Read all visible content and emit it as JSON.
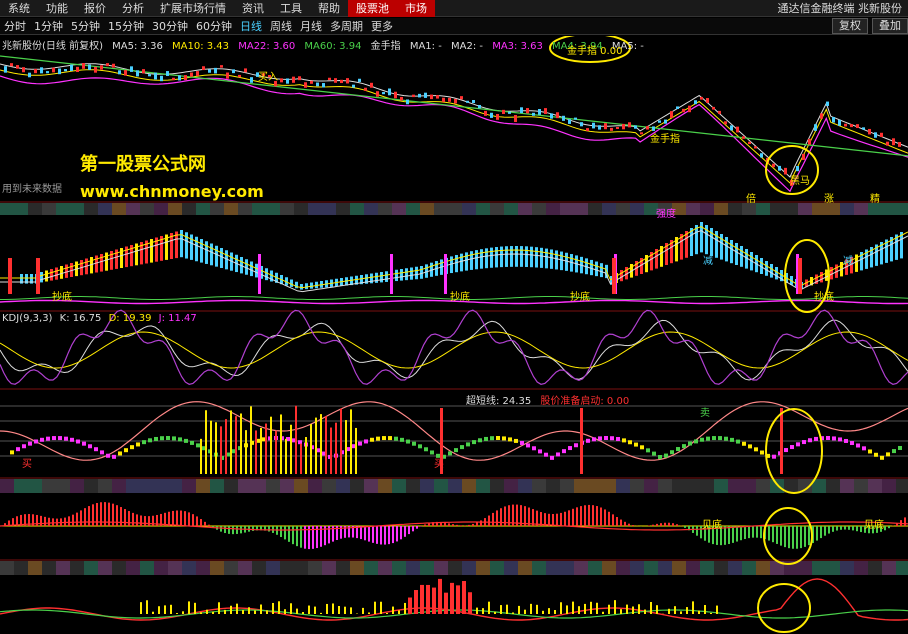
{
  "menu": {
    "items": [
      "系统",
      "功能",
      "报价",
      "分析",
      "扩展市场行情",
      "资讯",
      "工具",
      "帮助"
    ],
    "stock_pool": "股票池",
    "market": "市场",
    "app_title": "通达信金融终端  兆新股份"
  },
  "periods": {
    "items": [
      "分时",
      "1分钟",
      "5分钟",
      "15分钟",
      "30分钟",
      "60分钟",
      "日线",
      "周线",
      "月线",
      "多周期",
      "更多"
    ],
    "active": "日线",
    "restore_btn": "复权",
    "overlay_btn": "叠加"
  },
  "main_panel": {
    "title": "兆新股份(日线 前复权)",
    "ma5": "MA5: 3.36",
    "ma10": "MA10: 3.43",
    "ma22": "MA22: 3.60",
    "ma60": "MA60: 3.94",
    "indicator": "金手指",
    "ma1": "MA1: -",
    "ma2": "MA2: -",
    "ma3": "MA3: 3.63",
    "ma4": "MA4: 3.94",
    "ma5b": "MA5: -",
    "gold_label": "金手指  0.00",
    "future_note": "用到未来数据",
    "chart_labels": {
      "buy": "买入",
      "gold_finger": "金手指",
      "dark_horse": "黑马",
      "kong": "空",
      "up": "涨",
      "bei": "倍",
      "mark": "精"
    }
  },
  "watermark": {
    "line1": "第一股票公式网",
    "line2": "www.chnmoney.com"
  },
  "panel2": {
    "strength_label": "强度",
    "bottom_label": "抄底",
    "reduce_label": "减"
  },
  "panel3": {
    "title": "KDJ(9,3,3)",
    "k": "K: 16.75",
    "d": "D: 19.39",
    "j": "J: 11.47"
  },
  "panel4": {
    "title": "超短线: 24.35",
    "warn": "股价准备启动: 0.00",
    "buy": "买",
    "sell": "卖"
  },
  "panel5": {
    "label": "见底"
  },
  "colors": {
    "menu_red": "#bb0000",
    "yellow": "#ffea00",
    "cyan": "#4ad0ff",
    "magenta": "#ff33ff"
  }
}
